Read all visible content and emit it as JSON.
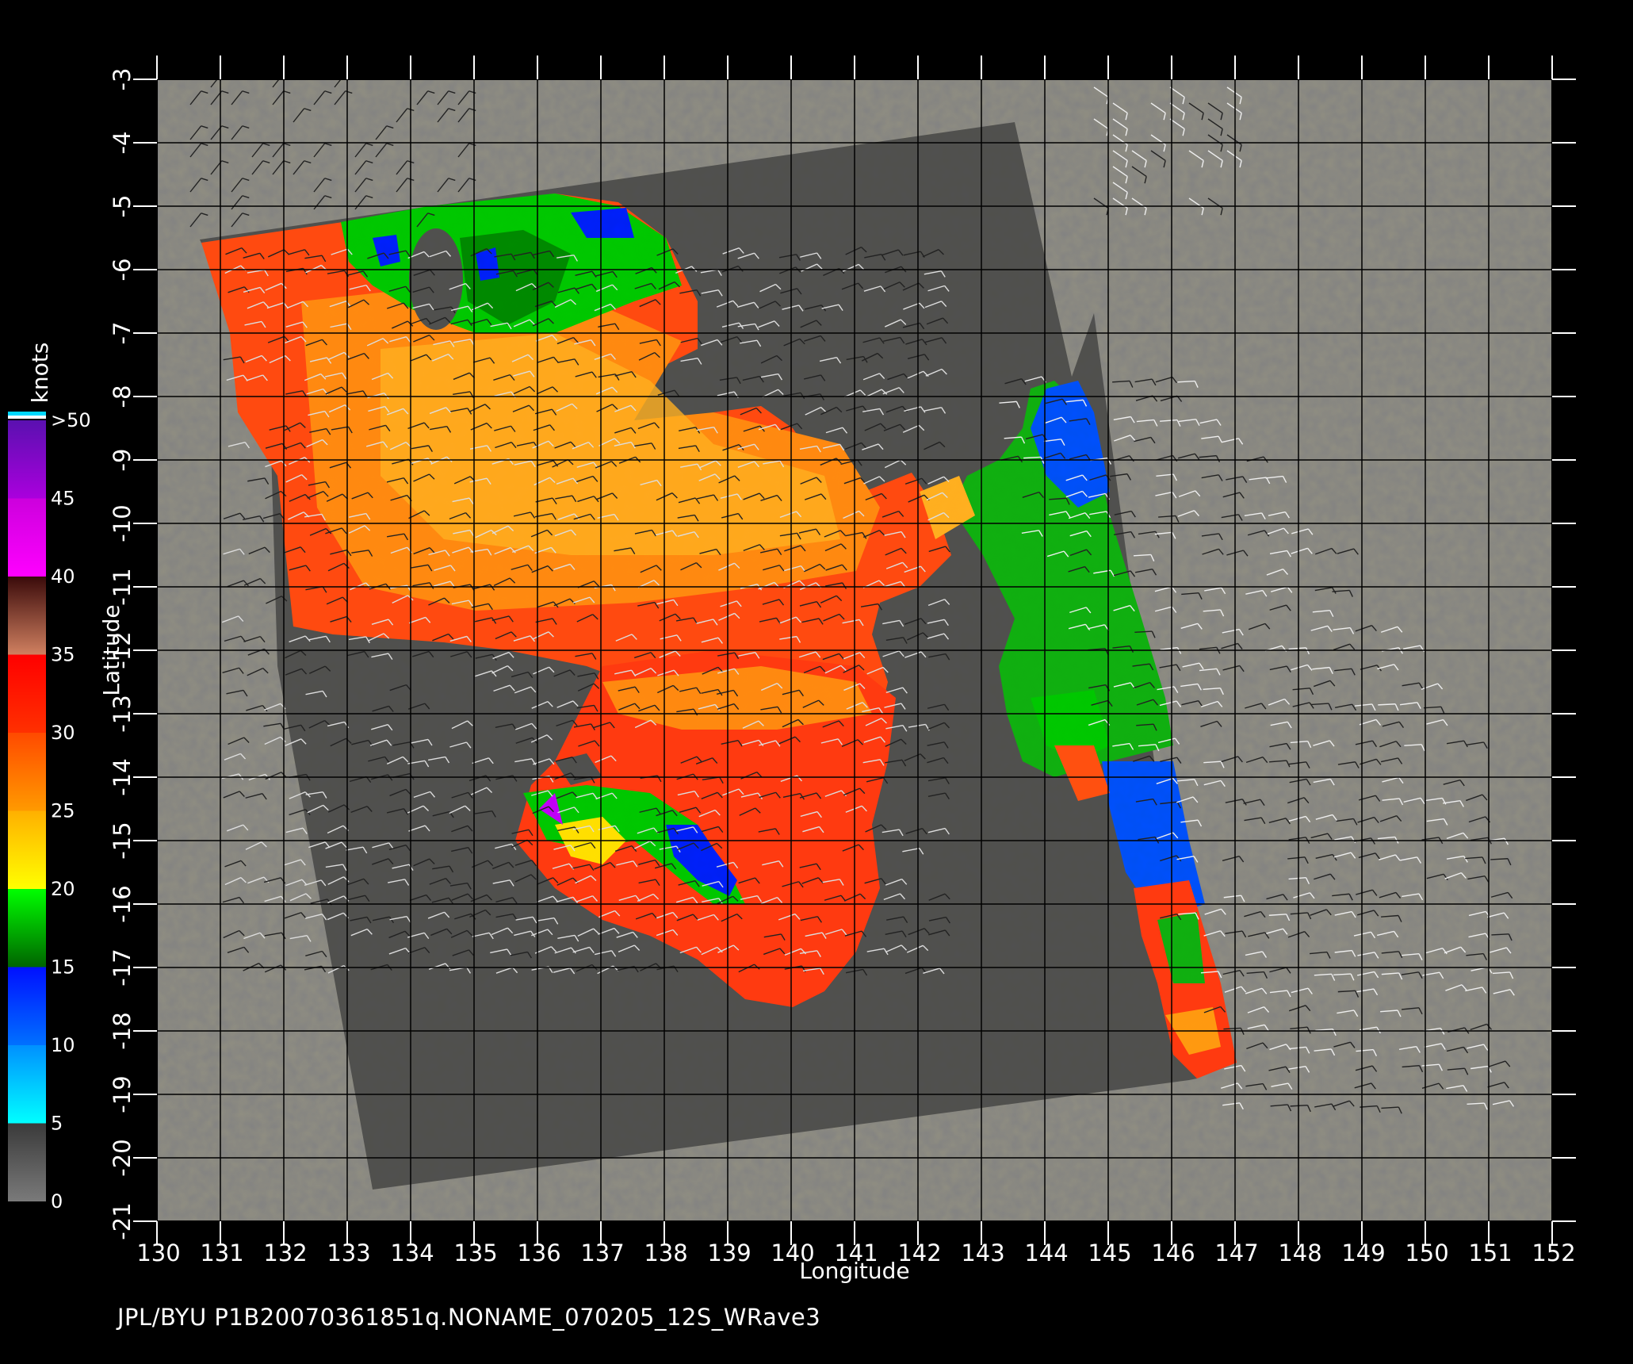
{
  "map": {
    "x_axis": {
      "title": "Longitude",
      "range": [
        130,
        152
      ],
      "tick_labels": [
        "130",
        "131",
        "132",
        "133",
        "134",
        "135",
        "136",
        "137",
        "138",
        "139",
        "140",
        "141",
        "142",
        "143",
        "144",
        "145",
        "146",
        "147",
        "148",
        "149",
        "150",
        "151",
        "152"
      ]
    },
    "y_axis": {
      "title": "Latitude",
      "range": [
        -21,
        -3
      ],
      "tick_labels": [
        "-3",
        "-4",
        "-5",
        "-6",
        "-7",
        "-8",
        "-9",
        "-10",
        "-11",
        "-12",
        "-13",
        "-14",
        "-15",
        "-16",
        "-17",
        "-18",
        "-19",
        "-20",
        "-21"
      ]
    },
    "grid": true,
    "colors": {
      "background": "#000000",
      "ocean_no_data": "#828282",
      "land_mask": "#505050",
      "grid_line": "#000000"
    }
  },
  "colorbar": {
    "unit": "knots",
    "labels": [
      "0",
      "5",
      "10",
      "15",
      "20",
      "25",
      "30",
      "35",
      "40",
      "45",
      ">50"
    ],
    "bands": [
      {
        "from": 0,
        "to": 5,
        "colors": [
          "#7a7a7a",
          "#3a3a3a"
        ]
      },
      {
        "from": 5,
        "to": 10,
        "colors": [
          "#00ffff",
          "#0090ff"
        ]
      },
      {
        "from": 10,
        "to": 15,
        "colors": [
          "#0070ff",
          "#0010ff"
        ]
      },
      {
        "from": 15,
        "to": 20,
        "colors": [
          "#006400",
          "#00ff00"
        ]
      },
      {
        "from": 20,
        "to": 25,
        "colors": [
          "#ffff00",
          "#ffb000"
        ]
      },
      {
        "from": 25,
        "to": 30,
        "colors": [
          "#ff9a00",
          "#ff4a00"
        ]
      },
      {
        "from": 30,
        "to": 35,
        "colors": [
          "#ff3000",
          "#ff0000"
        ]
      },
      {
        "from": 35,
        "to": 40,
        "colors": [
          "#d08060",
          "#3a0a0a"
        ]
      },
      {
        "from": 40,
        "to": 45,
        "colors": [
          "#ff00ff",
          "#cc00dd"
        ]
      },
      {
        "from": 45,
        "to": 50,
        "colors": [
          "#aa00dd",
          "#5a10b0"
        ]
      }
    ]
  },
  "caption": "JPL/BYU  P1B20070361851q.NONAME_070205_12S_WRave3",
  "wind_field": {
    "regions": [
      {
        "name": "top-left-swath",
        "color": "#ff4a10"
      },
      {
        "name": "gulf-swath",
        "color": "#ff8a10"
      },
      {
        "name": "north-green",
        "color": "#00c800"
      },
      {
        "name": "south-swath",
        "color": "#ff3a10"
      },
      {
        "name": "east-green",
        "color": "#10b010"
      },
      {
        "name": "east-blue",
        "color": "#0050ff"
      }
    ]
  }
}
